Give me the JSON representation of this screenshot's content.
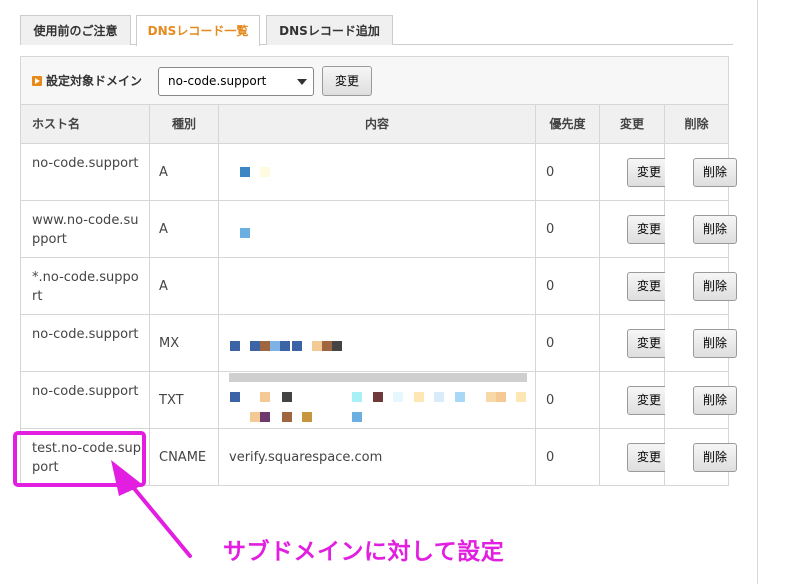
{
  "tabs": [
    {
      "label": "使用前のご注意",
      "active": false
    },
    {
      "label": "DNSレコード一覧",
      "active": true
    },
    {
      "label": "DNSレコード追加",
      "active": false
    }
  ],
  "domain_bar": {
    "label": "設定対象ドメイン",
    "selected": "no-code.support",
    "change_button": "変更"
  },
  "table": {
    "headers": [
      "ホスト名",
      "種別",
      "内容",
      "優先度",
      "変更",
      "削除"
    ],
    "rows": [
      {
        "host": "no-code.support",
        "type": "A",
        "content": "",
        "priority": "0",
        "edit": "変更",
        "delete": "削除"
      },
      {
        "host": "www.no-code.support",
        "type": "A",
        "content": "",
        "priority": "0",
        "edit": "変更",
        "delete": "削除"
      },
      {
        "host": "*.no-code.support",
        "type": "A",
        "content": "",
        "priority": "0",
        "edit": "変更",
        "delete": "削除"
      },
      {
        "host": "no-code.support",
        "type": "MX",
        "content": "",
        "priority": "0",
        "edit": "変更",
        "delete": "削除"
      },
      {
        "host": "no-code.support",
        "type": "TXT",
        "content": "",
        "priority": "0",
        "edit": "変更",
        "delete": "削除"
      },
      {
        "host": "test.no-code.support",
        "type": "CNAME",
        "content": "verify.squarespace.com",
        "priority": "0",
        "edit": "変更",
        "delete": "削除"
      }
    ]
  },
  "annotation": {
    "text": "サブドメインに対して設定",
    "color": "#e21ee0"
  },
  "colors": {
    "active_tab_text": "#e58a1f",
    "header_bg": "#f0f0f0"
  }
}
